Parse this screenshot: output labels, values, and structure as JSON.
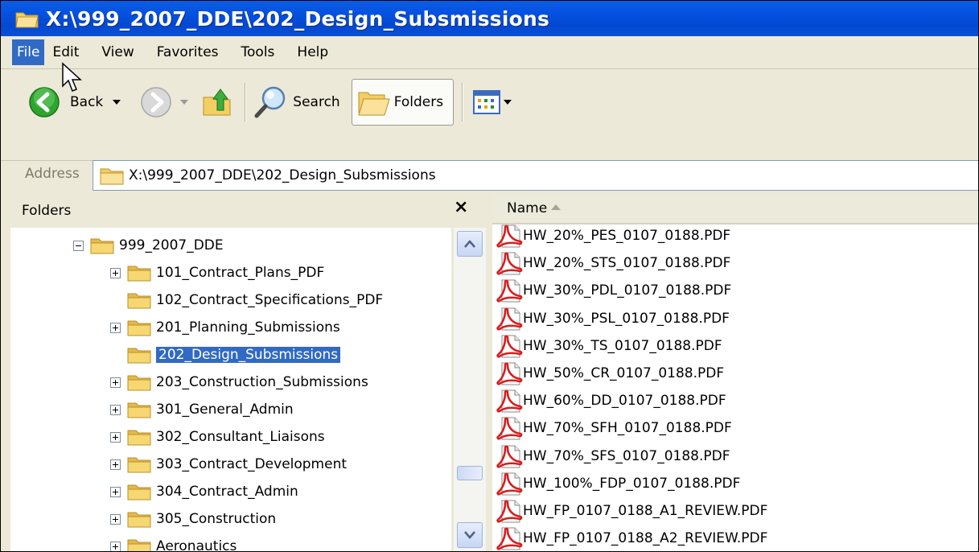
{
  "window": {
    "title": "X:\\999_2007_DDE\\202_Design_Subsmissions"
  },
  "menu": [
    "File",
    "Edit",
    "View",
    "Favorites",
    "Tools",
    "Help"
  ],
  "toolbar": {
    "back": "Back",
    "search": "Search",
    "folders": "Folders"
  },
  "address": {
    "label": "Address",
    "value": "X:\\999_2007_DDE\\202_Design_Subsmissions"
  },
  "folders_pane": {
    "title": "Folders",
    "close": "×",
    "tree": [
      {
        "name": "999_2007_DDE",
        "expander": "minus"
      },
      {
        "name": "101_Contract_Plans_PDF",
        "expander": "plus"
      },
      {
        "name": "102_Contract_Specifications_PDF",
        "expander": "none"
      },
      {
        "name": "201_Planning_Submissions",
        "expander": "plus"
      },
      {
        "name": "202_Design_Subsmissions",
        "expander": "none",
        "selected": true
      },
      {
        "name": "203_Construction_Submissions",
        "expander": "plus"
      },
      {
        "name": "301_General_Admin",
        "expander": "plus"
      },
      {
        "name": "302_Consultant_Liaisons",
        "expander": "plus"
      },
      {
        "name": "303_Contract_Development",
        "expander": "plus"
      },
      {
        "name": "304_Contract_Admin",
        "expander": "plus"
      },
      {
        "name": "305_Construction",
        "expander": "plus"
      },
      {
        "name": "Aeronautics",
        "expander": "plus"
      }
    ]
  },
  "file_list": {
    "column": "Name",
    "files": [
      "HW_20%_PES_0107_0188.PDF",
      "HW_20%_STS_0107_0188.PDF",
      "HW_30%_PDL_0107_0188.PDF",
      "HW_30%_PSL_0107_0188.PDF",
      "HW_30%_TS_0107_0188.PDF",
      "HW_50%_CR_0107_0188.PDF",
      "HW_60%_DD_0107_0188.PDF",
      "HW_70%_SFH_0107_0188.PDF",
      "HW_70%_SFS_0107_0188.PDF",
      "HW_100%_FDP_0107_0188.PDF",
      "HW_FP_0107_0188_A1_REVIEW.PDF",
      "HW_FP_0107_0188_A2_REVIEW.PDF"
    ]
  },
  "colors": {
    "titlebar": "#0550df",
    "selection": "#316ac5",
    "chrome": "#ece9d8",
    "folder": "#f3cf63",
    "pdf_red": "#d81e1e"
  },
  "icons": {
    "window": "folder-window-icon",
    "back": "back-arrow-icon",
    "forward": "forward-arrow-icon",
    "up": "up-folder-icon",
    "search": "magnifier-icon",
    "folders": "folders-icon",
    "views": "views-icon",
    "folder": "folder-icon",
    "file": "pdf-icon"
  }
}
